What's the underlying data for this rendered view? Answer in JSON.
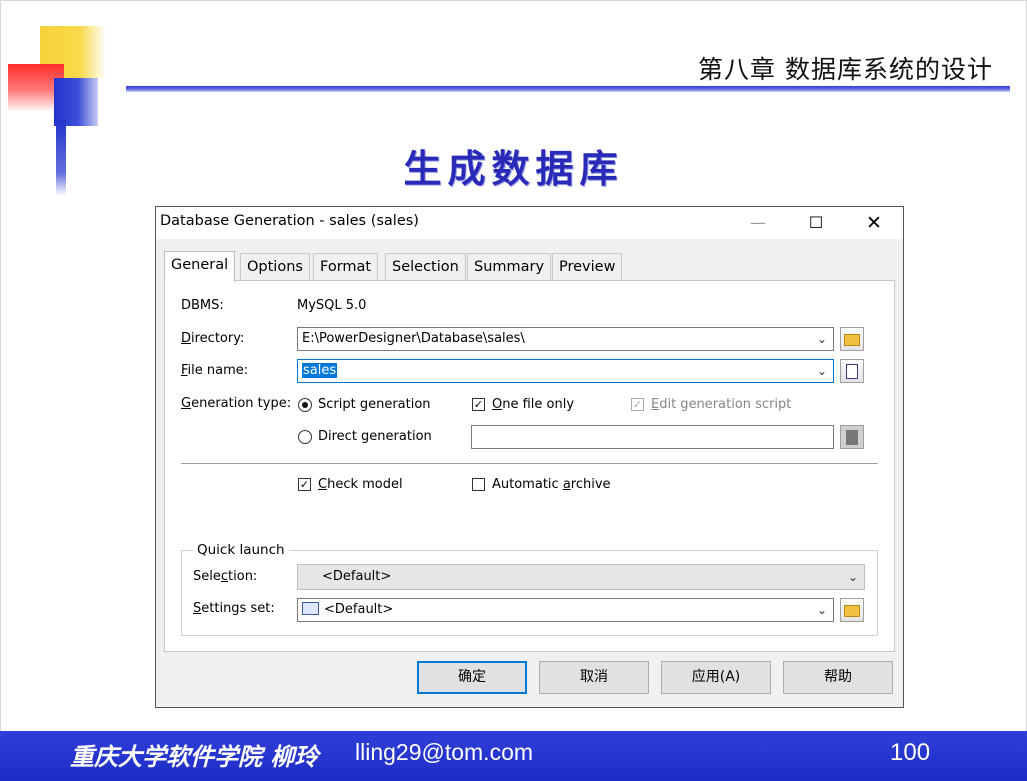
{
  "slide": {
    "chapter_title": "第八章 数据库系统的设计",
    "title": "生成数据库",
    "footer_author": "重庆大学软件学院 柳玲",
    "footer_email": "lling29@tom.com",
    "page_number": "100"
  },
  "dialog": {
    "title": "Database Generation - sales (sales)",
    "window_controls": {
      "minimize": "—",
      "maximize": "☐",
      "close": "✕"
    },
    "tabs": [
      "General",
      "Options",
      "Format",
      "Selection",
      "Summary",
      "Preview"
    ],
    "active_tab": "General",
    "dbms_label": "DBMS:",
    "dbms_value": "MySQL 5.0",
    "directory_label_first": "D",
    "directory_label_rest": "irectory:",
    "directory_value": "E:\\PowerDesigner\\Database\\sales\\",
    "filename_label_first": "F",
    "filename_label_rest": "ile name:",
    "filename_value": "sales",
    "generation_type_label_first": "G",
    "generation_type_label_rest": "eneration type:",
    "script_generation": "Script generation",
    "script_generation_selected": true,
    "direct_generation": "Direct generation",
    "one_file_only_first": "O",
    "one_file_only_rest": "ne file only",
    "one_file_only_checked": true,
    "edit_script_first": "E",
    "edit_script_rest": "dit generation script",
    "edit_script_checked": true,
    "edit_script_enabled": false,
    "check_model_first": "C",
    "check_model_rest": "heck model",
    "check_model_checked": true,
    "auto_archive_prefix": "Automatic ",
    "auto_archive_first": "a",
    "auto_archive_rest": "rchive",
    "auto_archive_checked": false,
    "quick_launch_title": "Quick launch",
    "selection_label_pre": "Sele",
    "selection_label_u": "c",
    "selection_label_post": "tion:",
    "selection_value": "<Default>",
    "settings_label_first": "S",
    "settings_label_rest": "ettings set:",
    "settings_value": "<Default>",
    "buttons": {
      "ok": "确定",
      "cancel": "取消",
      "apply": "应用(A)",
      "help": "帮助"
    }
  },
  "icons": [
    "folder-icon",
    "document-icon",
    "list-icon",
    "chevron-down-icon"
  ]
}
